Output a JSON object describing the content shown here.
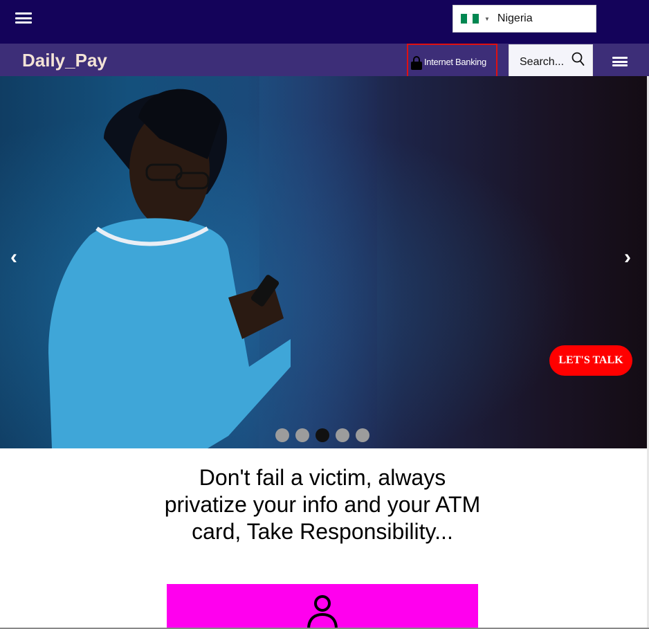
{
  "top_bar": {
    "country": {
      "label": "Nigeria",
      "flag": "nigeria-flag"
    }
  },
  "nav": {
    "brand": "Daily_Pay",
    "internet_banking": "Internet Banking",
    "search_placeholder": "Search..."
  },
  "carousel": {
    "prev": "‹",
    "next": "›",
    "slide_count": 5,
    "active_slide": 3
  },
  "lets_talk": "LET'S TALK",
  "headline": "Don't fail a victim, always privatize your info and your ATM card, Take Responsibility...",
  "colors": {
    "top_bar": "#14035a",
    "nav_bar": "#3d2e78",
    "brand": "#f3e3d6",
    "highlight": "#e01010",
    "lets_talk": "#ff0000",
    "card": "#ff00ee"
  }
}
